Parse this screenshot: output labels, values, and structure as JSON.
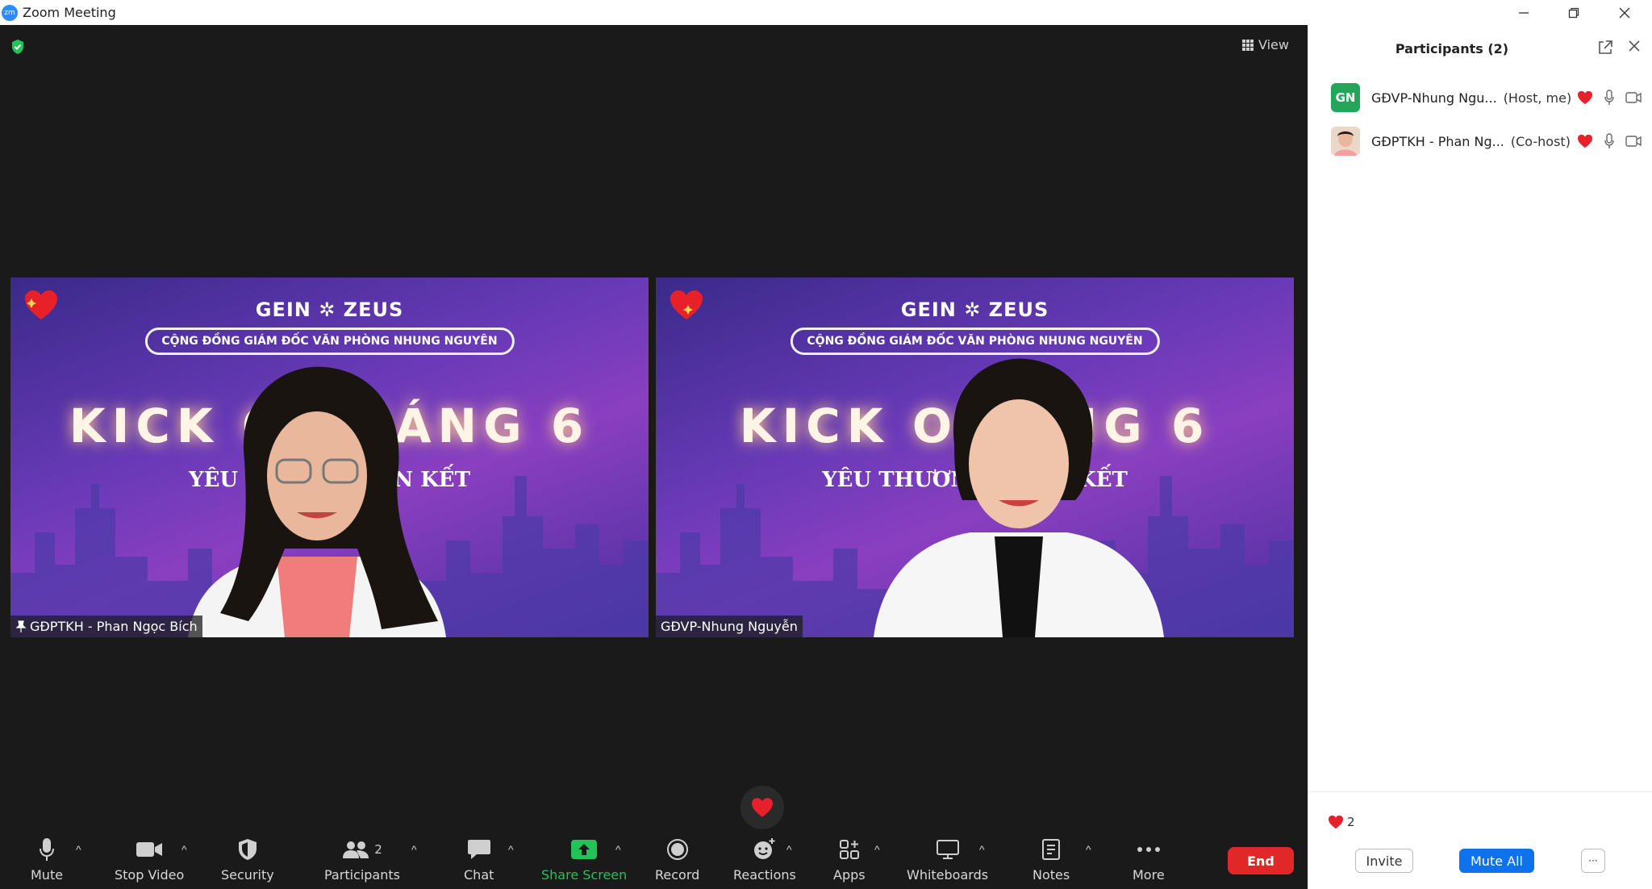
{
  "window": {
    "title": "Zoom Meeting",
    "logo_text": "zm"
  },
  "meeting": {
    "view_label": "View",
    "tiles": [
      {
        "name": "GĐPTKH - Phan Ngọc Bích",
        "pinned": true,
        "logos": "GEIN  ✲ ZEUS",
        "banner": "CỘNG ĐỒNG GIÁM ĐỐC VĂN PHÒNG NHUNG NGUYÊN",
        "headline": "KICK OF    HÁNG 6",
        "subline": "YÊU THƯƠN          - GẮN KẾT"
      },
      {
        "name": "GĐVP-Nhung Nguyễn",
        "pinned": false,
        "logos": "GEIN  ✲ ZEUS",
        "banner": "CỘNG ĐỒNG GIÁM ĐỐC VĂN PHÒNG NHUNG NGUYÊN",
        "headline": "KICK OFF      NG 6",
        "subline": "YÊU THƯƠNG - TR         N KẾT"
      }
    ]
  },
  "toolbar": {
    "mute": "Mute",
    "stop_video": "Stop Video",
    "security": "Security",
    "participants": "Participants",
    "participants_count": "2",
    "chat": "Chat",
    "share_screen": "Share Screen",
    "record": "Record",
    "reactions": "Reactions",
    "apps": "Apps",
    "whiteboards": "Whiteboards",
    "notes": "Notes",
    "more": "More",
    "end": "End",
    "caret": "^"
  },
  "panel": {
    "title": "Participants (2)",
    "participants": [
      {
        "initials": "GN",
        "name": "GĐVP-Nhung Ngu...",
        "role": "(Host, me)",
        "avatar_color": "#23a55a"
      },
      {
        "initials": "",
        "name": "GĐPTKH - Phan Ng...",
        "role": "(Co-host)",
        "avatar_color": "#d9b8a0"
      }
    ],
    "reaction_count": "2",
    "invite": "Invite",
    "mute_all": "Mute All",
    "more": "···"
  },
  "colors": {
    "accent_blue": "#0e72ed",
    "end_red": "#e02828",
    "share_green": "#23c35a",
    "heart": "#e8202a"
  }
}
